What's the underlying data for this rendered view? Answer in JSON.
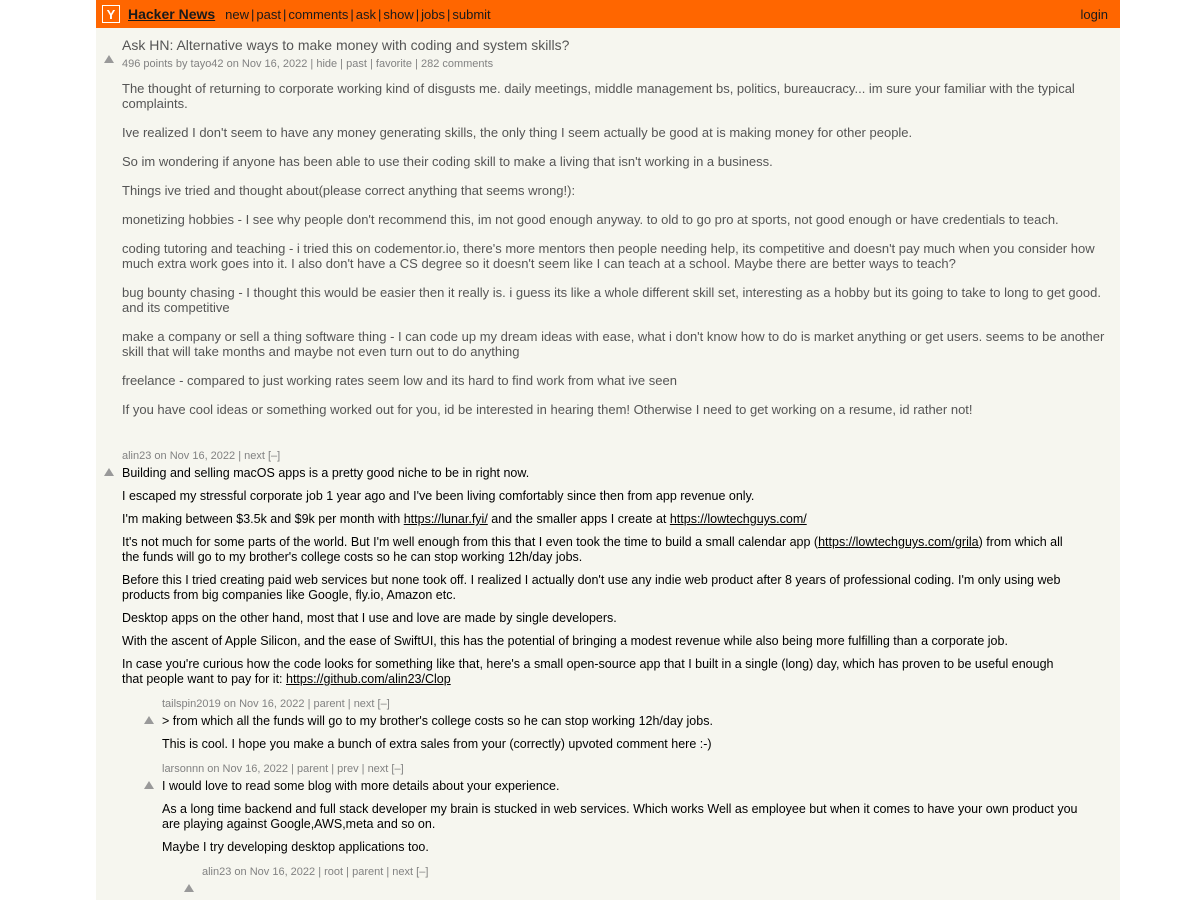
{
  "colors": {
    "brand_orange": "#ff6600",
    "page_bg": "#f6f6ef",
    "muted_text": "#828282",
    "story_text": "#555555"
  },
  "header": {
    "logo_letter": "Y",
    "site_title": "Hacker News",
    "nav": [
      {
        "label": "new"
      },
      {
        "label": "past"
      },
      {
        "label": "comments"
      },
      {
        "label": "ask"
      },
      {
        "label": "show"
      },
      {
        "label": "jobs"
      },
      {
        "label": "submit"
      }
    ],
    "separator": "|",
    "login_label": "login"
  },
  "story": {
    "title": "Ask HN: Alternative ways to make money with coding and system skills?",
    "points": "496 points",
    "by_label": "by",
    "author": "tayo42",
    "time": "on Nov 16, 2022",
    "actions": [
      "hide",
      "past",
      "favorite"
    ],
    "comments_label": "282 comments",
    "paragraphs": [
      "The thought of returning to corporate working kind of disgusts me. daily meetings, middle management bs, politics, bureaucracy... im sure your familiar with the typical complaints.",
      "Ive realized I don't seem to have any money generating skills, the only thing I seem actually be good at is making money for other people.",
      "So im wondering if anyone has been able to use their coding skill to make a living that isn't working in a business.",
      "Things ive tried and thought about(please correct anything that seems wrong!):",
      "monetizing hobbies - I see why people don't recommend this, im not good enough anyway. to old to go pro at sports, not good enough or have credentials to teach.",
      "coding tutoring and teaching - i tried this on codementor.io, there's more mentors then people needing help, its competitive and doesn't pay much when you consider how much extra work goes into it. I also don't have a CS degree so it doesn't seem like I can teach at a school. Maybe there are better ways to teach?",
      "bug bounty chasing - I thought this would be easier then it really is. i guess its like a whole different skill set, interesting as a hobby but its going to take to long to get good. and its competitive",
      "make a company or sell a thing software thing - I can code up my dream ideas with ease, what i don't know how to do is market anything or get users. seems to be another skill that will take months and maybe not even turn out to do anything",
      "freelance - compared to just working rates seem low and its hard to find work from what ive seen",
      "If you have cool ideas or something worked out for you, id be interested in hearing them! Otherwise I need to get working on a resume, id rather not!"
    ]
  },
  "comments": [
    {
      "indent": 0,
      "author": "alin23",
      "time": "on Nov 16, 2022",
      "links": [
        "next"
      ],
      "toggle": "[–]",
      "separator": "|",
      "paragraphs": [
        {
          "parts": [
            {
              "type": "text",
              "text": "Building and selling macOS apps is a pretty good niche to be in right now."
            }
          ]
        },
        {
          "parts": [
            {
              "type": "text",
              "text": "I escaped my stressful corporate job 1 year ago and I've been living comfortably since then from app revenue only."
            }
          ]
        },
        {
          "parts": [
            {
              "type": "text",
              "text": "I'm making between $3.5k and $9k per month with "
            },
            {
              "type": "link",
              "text": "https://lunar.fyi/"
            },
            {
              "type": "text",
              "text": " and the smaller apps I create at "
            },
            {
              "type": "link",
              "text": "https://lowtechguys.com/"
            }
          ]
        },
        {
          "parts": [
            {
              "type": "text",
              "text": "It's not much for some parts of the world. But I'm well enough from this that I even took the time to build a small calendar app ("
            },
            {
              "type": "link",
              "text": "https://lowtechguys.com/grila"
            },
            {
              "type": "text",
              "text": ") from which all the funds will go to my brother's college costs so he can stop working 12h/day jobs."
            }
          ]
        },
        {
          "parts": [
            {
              "type": "text",
              "text": "Before this I tried creating paid web services but none took off. I realized I actually don't use any indie web product after 8 years of professional coding. I'm only using web products from big companies like Google, fly.io, Amazon etc."
            }
          ]
        },
        {
          "parts": [
            {
              "type": "text",
              "text": "Desktop apps on the other hand, most that I use and love are made by single developers."
            }
          ]
        },
        {
          "parts": [
            {
              "type": "text",
              "text": "With the ascent of Apple Silicon, and the ease of SwiftUI, this has the potential of bringing a modest revenue while also being more fulfilling than a corporate job."
            }
          ]
        },
        {
          "parts": [
            {
              "type": "text",
              "text": "In case you're curious how the code looks for something like that, here's a small open-source app that I built in a single (long) day, which has proven to be useful enough that people want to pay for it: "
            },
            {
              "type": "link",
              "text": "https://github.com/alin23/Clop"
            }
          ]
        }
      ]
    },
    {
      "indent": 1,
      "author": "tailspin2019",
      "time": "on Nov 16, 2022",
      "links": [
        "parent",
        "next"
      ],
      "toggle": "[–]",
      "separator": "|",
      "paragraphs": [
        {
          "parts": [
            {
              "type": "text",
              "text": "> from which all the funds will go to my brother's college costs so he can stop working 12h/day jobs."
            }
          ]
        },
        {
          "parts": [
            {
              "type": "text",
              "text": "This is cool. I hope you make a bunch of extra sales from your (correctly) upvoted comment here :-)"
            }
          ]
        }
      ]
    },
    {
      "indent": 1,
      "author": "larsonnn",
      "time": "on Nov 16, 2022",
      "links": [
        "parent",
        "prev",
        "next"
      ],
      "toggle": "[–]",
      "separator": "|",
      "paragraphs": [
        {
          "parts": [
            {
              "type": "text",
              "text": "I would love to read some blog with more details about your experience."
            }
          ]
        },
        {
          "parts": [
            {
              "type": "text",
              "text": "As a long time backend and full stack developer my brain is stucked in web services. Which works Well as employee but when it comes to have your own product you are playing against Google,AWS,meta and so on."
            }
          ]
        },
        {
          "parts": [
            {
              "type": "text",
              "text": "Maybe I try developing desktop applications too."
            }
          ]
        }
      ]
    },
    {
      "indent": 2,
      "author": "alin23",
      "time": "on Nov 16, 2022",
      "links": [
        "root",
        "parent",
        "next"
      ],
      "toggle": "[–]",
      "separator": "|",
      "paragraphs": []
    }
  ]
}
